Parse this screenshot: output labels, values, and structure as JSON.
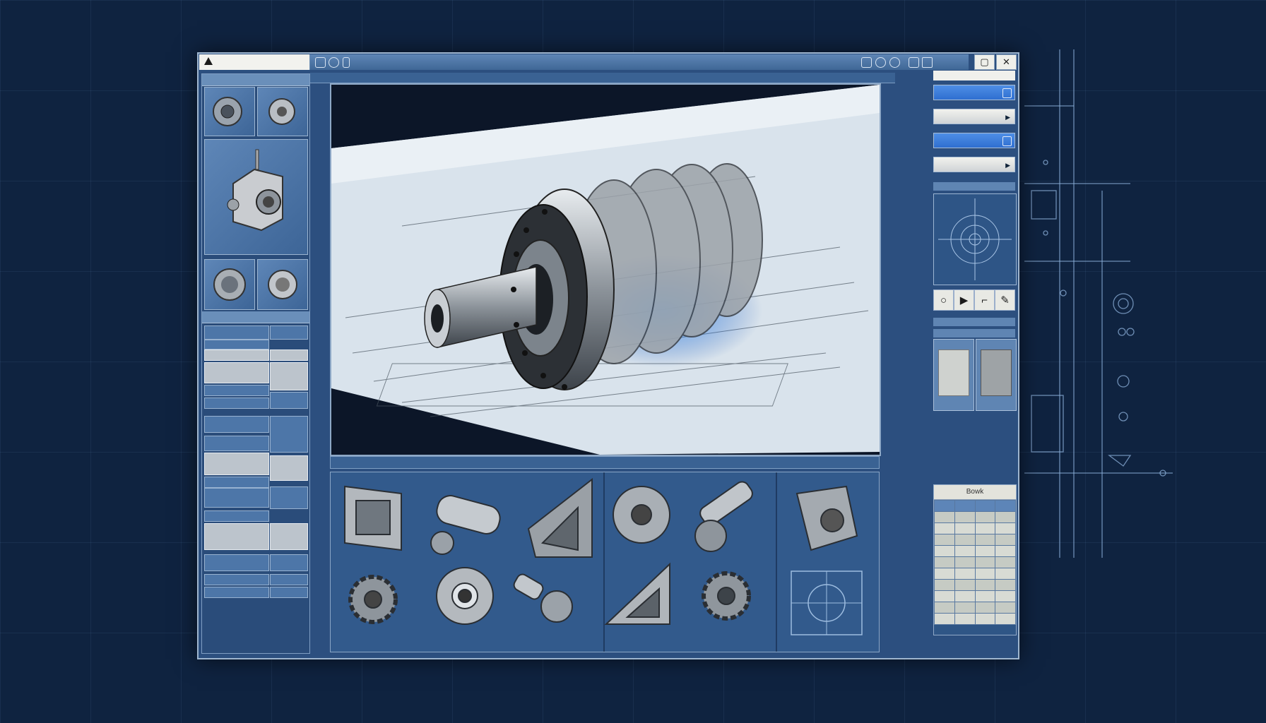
{
  "titlebar": {
    "maximize_label": "▢",
    "close_label": "✕",
    "icons": [
      "view-icon",
      "orbit-icon",
      "grid-icon",
      "print-icon",
      "zoom-icon",
      "snap-icon",
      "layer-icon"
    ]
  },
  "left_panel": {
    "header": "",
    "subheader": "",
    "thumbnails": [
      "part-flange",
      "part-hub",
      "part-valve-body",
      "part-ring",
      "part-seal"
    ]
  },
  "viewport": {
    "model": "rotor-shaft-assembly",
    "toolbar_icons": [
      "fit-icon",
      "pan-icon",
      "rotate-icon",
      "section-icon"
    ]
  },
  "gallery": {
    "items": [
      "bracket-frame",
      "coupling-pipe",
      "gusset-plate",
      "flange-wheel",
      "shaft-pin",
      "gear-small",
      "bearing-ring",
      "bolt-stud",
      "corner-brace",
      "gear-pinion",
      "housing-block",
      "drawing-plan"
    ]
  },
  "right_panel": {
    "label_top": "",
    "buttons": [
      {
        "label": "",
        "style": "sel"
      },
      {
        "label": "",
        "style": "plain"
      },
      {
        "label": "",
        "style": "sel"
      },
      {
        "label": "",
        "style": "plain"
      }
    ],
    "section1": "",
    "tools": [
      "○",
      "▶",
      "⌐",
      "✎"
    ],
    "section2": "",
    "section3": "",
    "table_header": "Bowk"
  },
  "colors": {
    "accent": "#3f78d8",
    "panel": "#2c4f7f",
    "background": "#0f2340"
  }
}
